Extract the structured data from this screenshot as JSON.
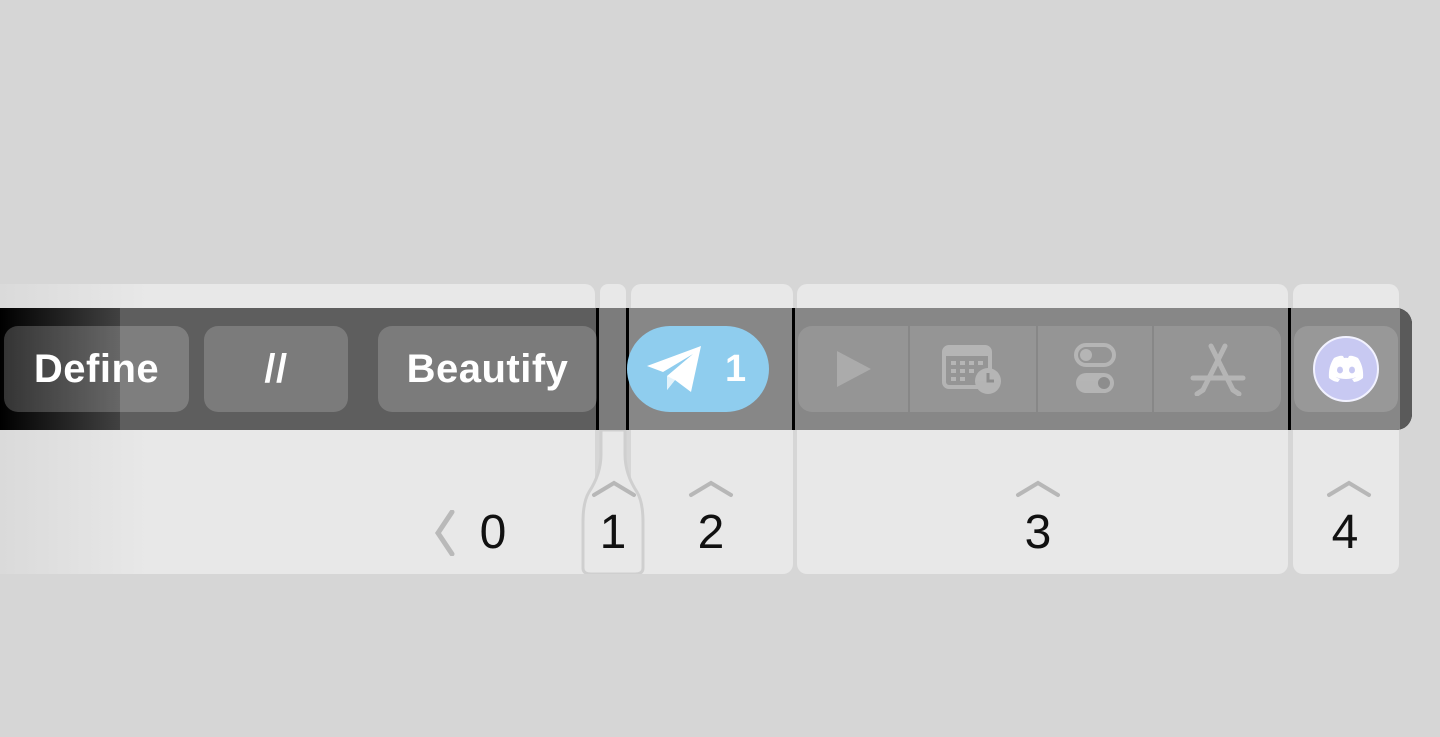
{
  "touch_bar": {
    "group0": {
      "keys": [
        "Define",
        "//",
        "Beautify"
      ],
      "number": "0"
    },
    "group1": {
      "number": "1"
    },
    "group2": {
      "app": "telegram",
      "icon": "paper-plane-icon",
      "badge_count": "1",
      "number": "2",
      "accent": "#8fcdee"
    },
    "group3": {
      "icons": [
        "play-icon",
        "calendar-clock-icon",
        "toggle-switches-icon",
        "app-store-icon"
      ],
      "number": "3"
    },
    "group4": {
      "icon": "discord-icon",
      "number": "4",
      "accent": "#c8c9f2"
    }
  }
}
